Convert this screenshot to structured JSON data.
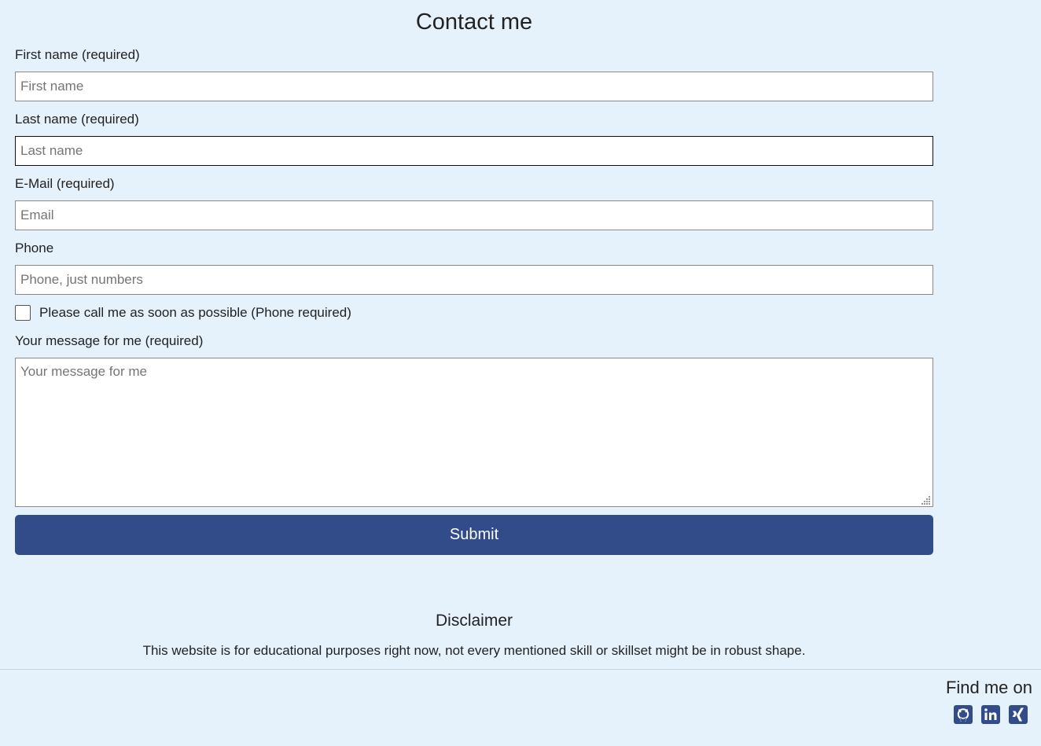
{
  "page": {
    "title": "Contact me"
  },
  "form": {
    "first_name": {
      "label": "First name (required)",
      "placeholder": "First name",
      "value": ""
    },
    "last_name": {
      "label": "Last name (required)",
      "placeholder": "Last name",
      "value": ""
    },
    "email": {
      "label": "E-Mail (required)",
      "placeholder": "Email",
      "value": ""
    },
    "phone": {
      "label": "Phone",
      "placeholder": "Phone, just numbers",
      "value": ""
    },
    "callback": {
      "label": "Please call me as soon as possible (Phone required)",
      "checked": false
    },
    "message": {
      "label": "Your message for me (required)",
      "placeholder": "Your message for me",
      "value": ""
    },
    "submit_label": "Submit"
  },
  "disclaimer": {
    "title": "Disclaimer",
    "text": "This website is for educational purposes right now, not every mentioned skill or skillset might be in robust shape."
  },
  "footer": {
    "find_me_label": "Find me on",
    "social": [
      {
        "icon": "github-icon"
      },
      {
        "icon": "linkedin-icon"
      },
      {
        "icon": "xing-icon"
      }
    ]
  },
  "colors": {
    "background": "#e6f2fb",
    "accent": "#314c89"
  }
}
